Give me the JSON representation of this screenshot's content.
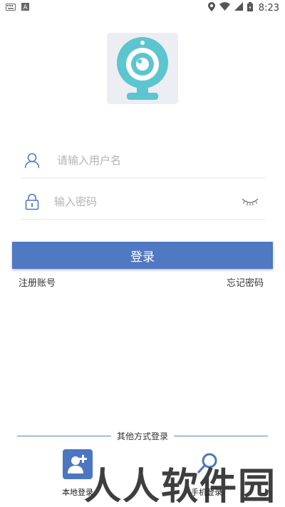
{
  "status_bar": {
    "time": "8:23",
    "icons": [
      "keyboard-icon",
      "a-app-icon",
      "location-icon",
      "wifi-icon",
      "signal-icon",
      "battery-icon"
    ]
  },
  "login": {
    "username_placeholder": "请输入用户名",
    "password_placeholder": "输入密码",
    "login_label": "登录",
    "register_label": "注册账号",
    "forgot_label": "忘记密码"
  },
  "other_methods": {
    "title": "其他方式登录",
    "local_label": "本地登录",
    "phone_label": "手机登录"
  },
  "watermark": "人人软件园",
  "colors": {
    "accent": "#5078c3",
    "logo_teal": "#5cc5cf",
    "divider_blue": "#5a86c8"
  }
}
